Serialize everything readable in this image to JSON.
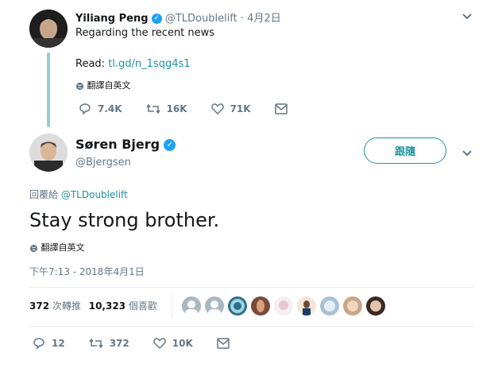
{
  "parent_tweet": {
    "name": "Yiliang Peng",
    "handle": "@TLDoublelift",
    "date": "· 4月2日",
    "text": "Regarding the recent news",
    "read_label": "Read:",
    "link": "tl.gd/n_1sqg4s1",
    "translate": "翻譯自英文",
    "replies": "7.4K",
    "retweets": "16K",
    "likes": "71K"
  },
  "main_tweet": {
    "name": "Søren Bjerg",
    "handle": "@Bjergsen",
    "follow_label": "跟隨",
    "reply_prefix": "回覆給",
    "reply_to": "@TLDoublelift",
    "text": "Stay strong brother.",
    "translate": "翻譯自英文",
    "timestamp": "下午7:13 - 2018年4月1日",
    "retweet_count": "372",
    "retweet_label": "次轉推",
    "like_count": "10,323",
    "like_label": "個喜歡",
    "replies": "12",
    "retweets": "372",
    "likes": "10K"
  },
  "colors": {
    "accent": "#1b95a0",
    "verified": "#1da1f2",
    "text_secondary": "#657786"
  }
}
